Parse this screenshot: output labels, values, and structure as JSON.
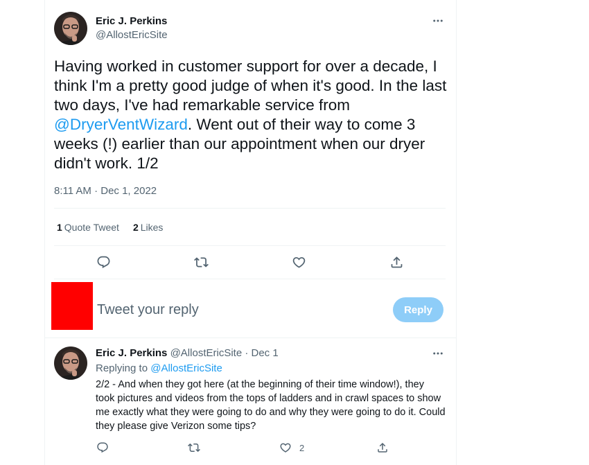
{
  "tweet": {
    "author_name": "Eric J. Perkins",
    "author_handle": "@AllostEricSite",
    "text_part1": "Having worked in customer support for over a decade, I think I'm a pretty good judge of when it's good. In the last two days, I've had remarkable service from ",
    "mention": "@DryerVentWizard",
    "text_part2": ". Went out of their way to come 3 weeks (!) earlier than our appointment when our dryer didn't work. 1/2",
    "timestamp": "8:11 AM · Dec 1, 2022",
    "quote_count": "1",
    "quote_label": "Quote Tweet",
    "like_count": "2",
    "like_label": "Likes"
  },
  "composer": {
    "placeholder": "Tweet your reply",
    "button_label": "Reply"
  },
  "reply": {
    "author_name": "Eric J. Perkins",
    "author_handle": "@AllostEricSite",
    "date": "· Dec 1",
    "replying_to_label": "Replying to ",
    "replying_to_handle": "@AllostEricSite",
    "text": "2/2 - And when they got here (at the beginning of their time window!), they took pictures and videos from the tops of ladders and in crawl spaces to show me exactly what they were going to do and why they were going to do it. Could they please give Verizon some tips?",
    "like_count": "2"
  },
  "icons": {
    "reply": "reply-icon",
    "retweet": "retweet-icon",
    "like": "heart-icon",
    "share": "share-icon",
    "more": "more-icon"
  },
  "colors": {
    "accent": "#1d9bf0",
    "muted": "#536471",
    "reply_button_disabled": "#8ecdf8",
    "redaction": "#ff0000"
  }
}
